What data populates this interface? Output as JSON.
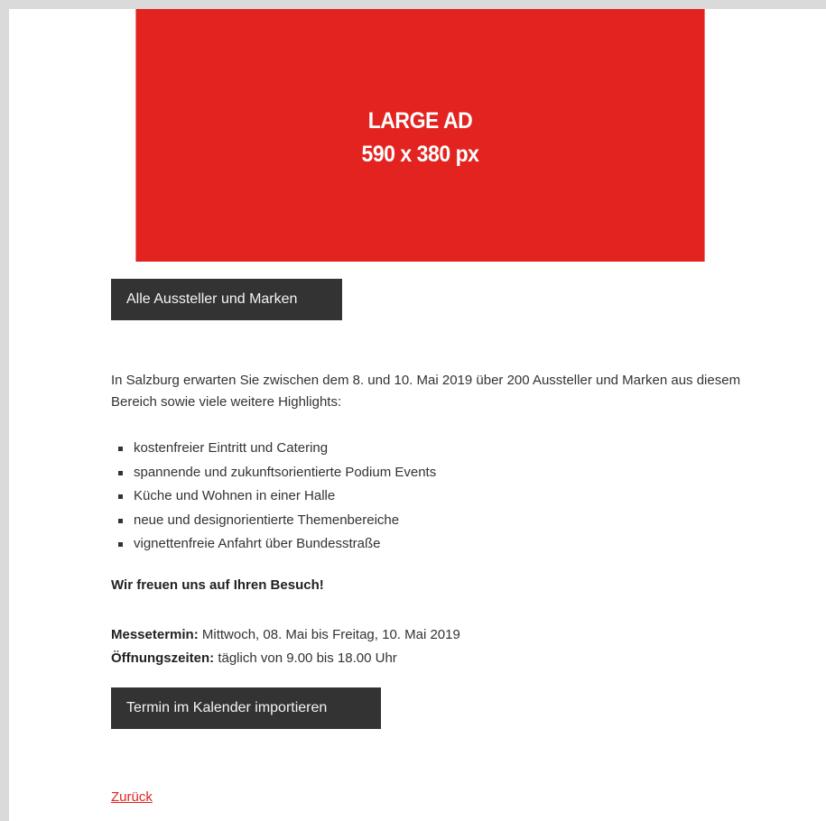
{
  "ad": {
    "line1": "LARGE AD",
    "line2": "590 x 380 px",
    "background": "#e2231f"
  },
  "buttons": {
    "exhibitors_label": "Alle Aussteller und Marken",
    "calendar_label": "Termin im Kalender importieren"
  },
  "intro": {
    "text": "In Salzburg erwarten Sie zwischen dem 8. und 10. Mai 2019 über 200 Aussteller und Marken aus diesem Bereich sowie viele weitere Highlights:"
  },
  "highlights": [
    "kostenfreier Eintritt und Catering",
    "spannende und zukunftsorientierte Podium Events",
    "Küche und Wohnen in einer Halle",
    "neue und designorientierte Themenbereiche",
    "vignettenfreie Anfahrt über Bundesstraße"
  ],
  "closing": "Wir freuen uns auf Ihren Besuch!",
  "details": {
    "date_label": "Messetermin:",
    "date_value": "Mittwoch, 08. Mai bis Freitag, 10. Mai 2019",
    "hours_label": "Öffnungszeiten:",
    "hours_value": "täglich von 9.00 bis 18.00 Uhr"
  },
  "back_link": "Zurück",
  "colors": {
    "accent": "#e2231f",
    "button": "#333333",
    "frame": "#d9dad9"
  }
}
